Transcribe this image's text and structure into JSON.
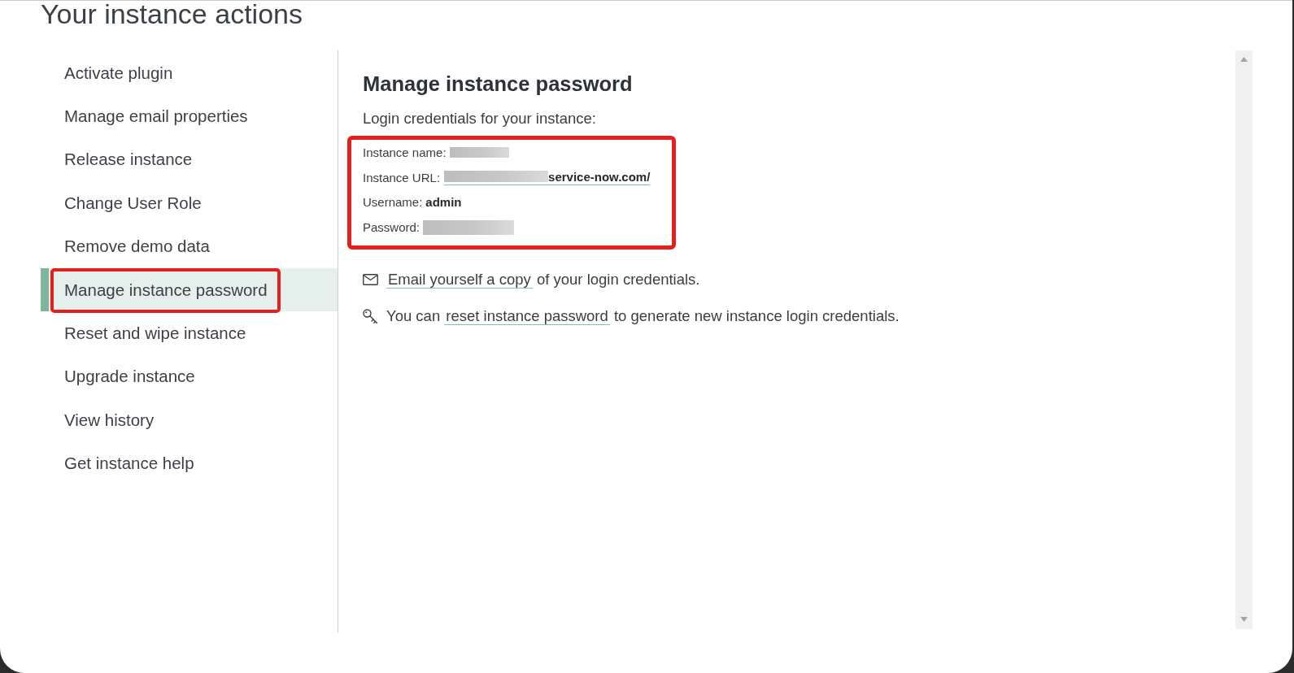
{
  "page": {
    "title": "Your instance actions"
  },
  "sidebar": {
    "items": [
      {
        "label": "Activate plugin",
        "selected": false,
        "annotated": false
      },
      {
        "label": "Manage email properties",
        "selected": false,
        "annotated": false
      },
      {
        "label": "Release instance",
        "selected": false,
        "annotated": false
      },
      {
        "label": "Change User Role",
        "selected": false,
        "annotated": false
      },
      {
        "label": "Remove demo data",
        "selected": false,
        "annotated": false
      },
      {
        "label": "Manage instance password",
        "selected": true,
        "annotated": true
      },
      {
        "label": "Reset and wipe instance",
        "selected": false,
        "annotated": false
      },
      {
        "label": "Upgrade instance",
        "selected": false,
        "annotated": false
      },
      {
        "label": "View history",
        "selected": false,
        "annotated": false
      },
      {
        "label": "Get instance help",
        "selected": false,
        "annotated": false
      }
    ]
  },
  "content": {
    "heading": "Manage instance password",
    "intro": "Login credentials for your instance:",
    "credentials": {
      "annotated": true,
      "rows": [
        {
          "kind": "plain",
          "label": "Instance name:",
          "redacted": true
        },
        {
          "kind": "link",
          "label": "Instance URL:",
          "redacted": true,
          "value": "service-now.com/"
        },
        {
          "kind": "plain",
          "label": "Username:",
          "value": "admin"
        },
        {
          "kind": "plain",
          "label": "Password:",
          "redacted": true
        }
      ]
    },
    "actions": [
      {
        "kind": "email",
        "link": "Email yourself a copy",
        "after": "of your login credentials."
      },
      {
        "kind": "key",
        "before": "You can",
        "link": "reset instance password",
        "after": "to generate new instance login credentials."
      }
    ]
  }
}
